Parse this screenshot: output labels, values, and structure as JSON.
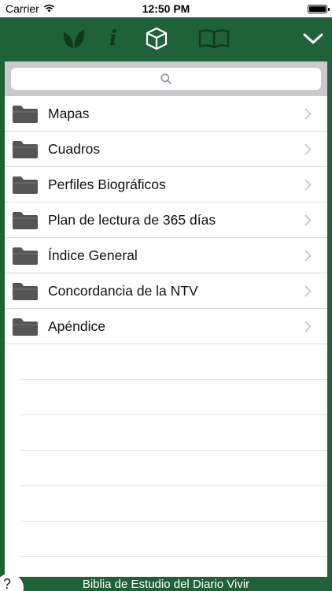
{
  "status_bar": {
    "carrier": "Carrier",
    "time": "12:50 PM",
    "battery_level": 1.0
  },
  "toolbar": {
    "buttons": [
      {
        "icon": "leaf-icon",
        "active": false
      },
      {
        "icon": "info-icon",
        "glyph": "i",
        "active": false
      },
      {
        "icon": "cube-icon",
        "active": true
      },
      {
        "icon": "book-icon",
        "active": false
      },
      {
        "icon": "chevron-down-icon",
        "active": true
      }
    ]
  },
  "search": {
    "icon": "search-icon",
    "placeholder": ""
  },
  "list": {
    "items": [
      {
        "label": "Mapas",
        "icon": "folder-icon"
      },
      {
        "label": "Cuadros",
        "icon": "folder-icon"
      },
      {
        "label": "Perfiles Biográficos",
        "icon": "folder-icon"
      },
      {
        "label": "Plan de lectura de 365 días",
        "icon": "folder-icon"
      },
      {
        "label": "Índice General",
        "icon": "folder-icon"
      },
      {
        "label": "Concordancia de la NTV",
        "icon": "folder-icon"
      },
      {
        "label": "Apéndice",
        "icon": "folder-icon"
      }
    ]
  },
  "footer": {
    "title": "Biblia de Estudio del Diario Vivir",
    "help_label": "?"
  },
  "colors": {
    "chrome_green": "#1f6138",
    "inactive_icon": "#0f3a1f",
    "active_icon": "#ffffff",
    "search_bar_bg": "#c9c9ce",
    "folder_gray": "#555555"
  }
}
